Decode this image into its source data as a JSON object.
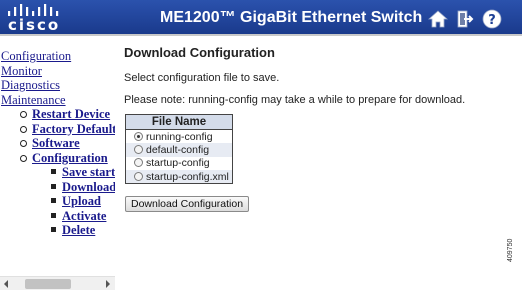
{
  "header": {
    "logo_text": "cisco",
    "title": "ME1200™ GigaBit Ethernet Switch",
    "icons": [
      "home-icon",
      "logout-icon",
      "help-icon"
    ]
  },
  "sidebar": {
    "items": [
      {
        "label": "Configuration",
        "level": 1
      },
      {
        "label": "Monitor",
        "level": 1
      },
      {
        "label": "Diagnostics",
        "level": 1
      },
      {
        "label": "Maintenance",
        "level": 1
      },
      {
        "label": "Restart Device",
        "level": 2
      },
      {
        "label": "Factory Defaults",
        "level": 2
      },
      {
        "label": "Software",
        "level": 2
      },
      {
        "label": "Configuration",
        "level": 2
      },
      {
        "label": "Save startup-config",
        "level": 3
      },
      {
        "label": "Download",
        "level": 3
      },
      {
        "label": "Upload",
        "level": 3
      },
      {
        "label": "Activate",
        "level": 3
      },
      {
        "label": "Delete",
        "level": 3
      }
    ]
  },
  "main": {
    "title": "Download Configuration",
    "instruction": "Select configuration file to save.",
    "note": "Please note: running-config may take a while to prepare for download.",
    "table": {
      "header": "File Name",
      "rows": [
        {
          "label": "running-config",
          "selected": true
        },
        {
          "label": "default-config",
          "selected": false
        },
        {
          "label": "startup-config",
          "selected": false
        },
        {
          "label": "startup-config.xml",
          "selected": false
        }
      ]
    },
    "button_label": "Download Configuration"
  },
  "figure_id": "409750",
  "colors": {
    "header_bg": "#1c3f94",
    "link": "#1a1a8c",
    "table_header_bg": "#d4dcea"
  }
}
